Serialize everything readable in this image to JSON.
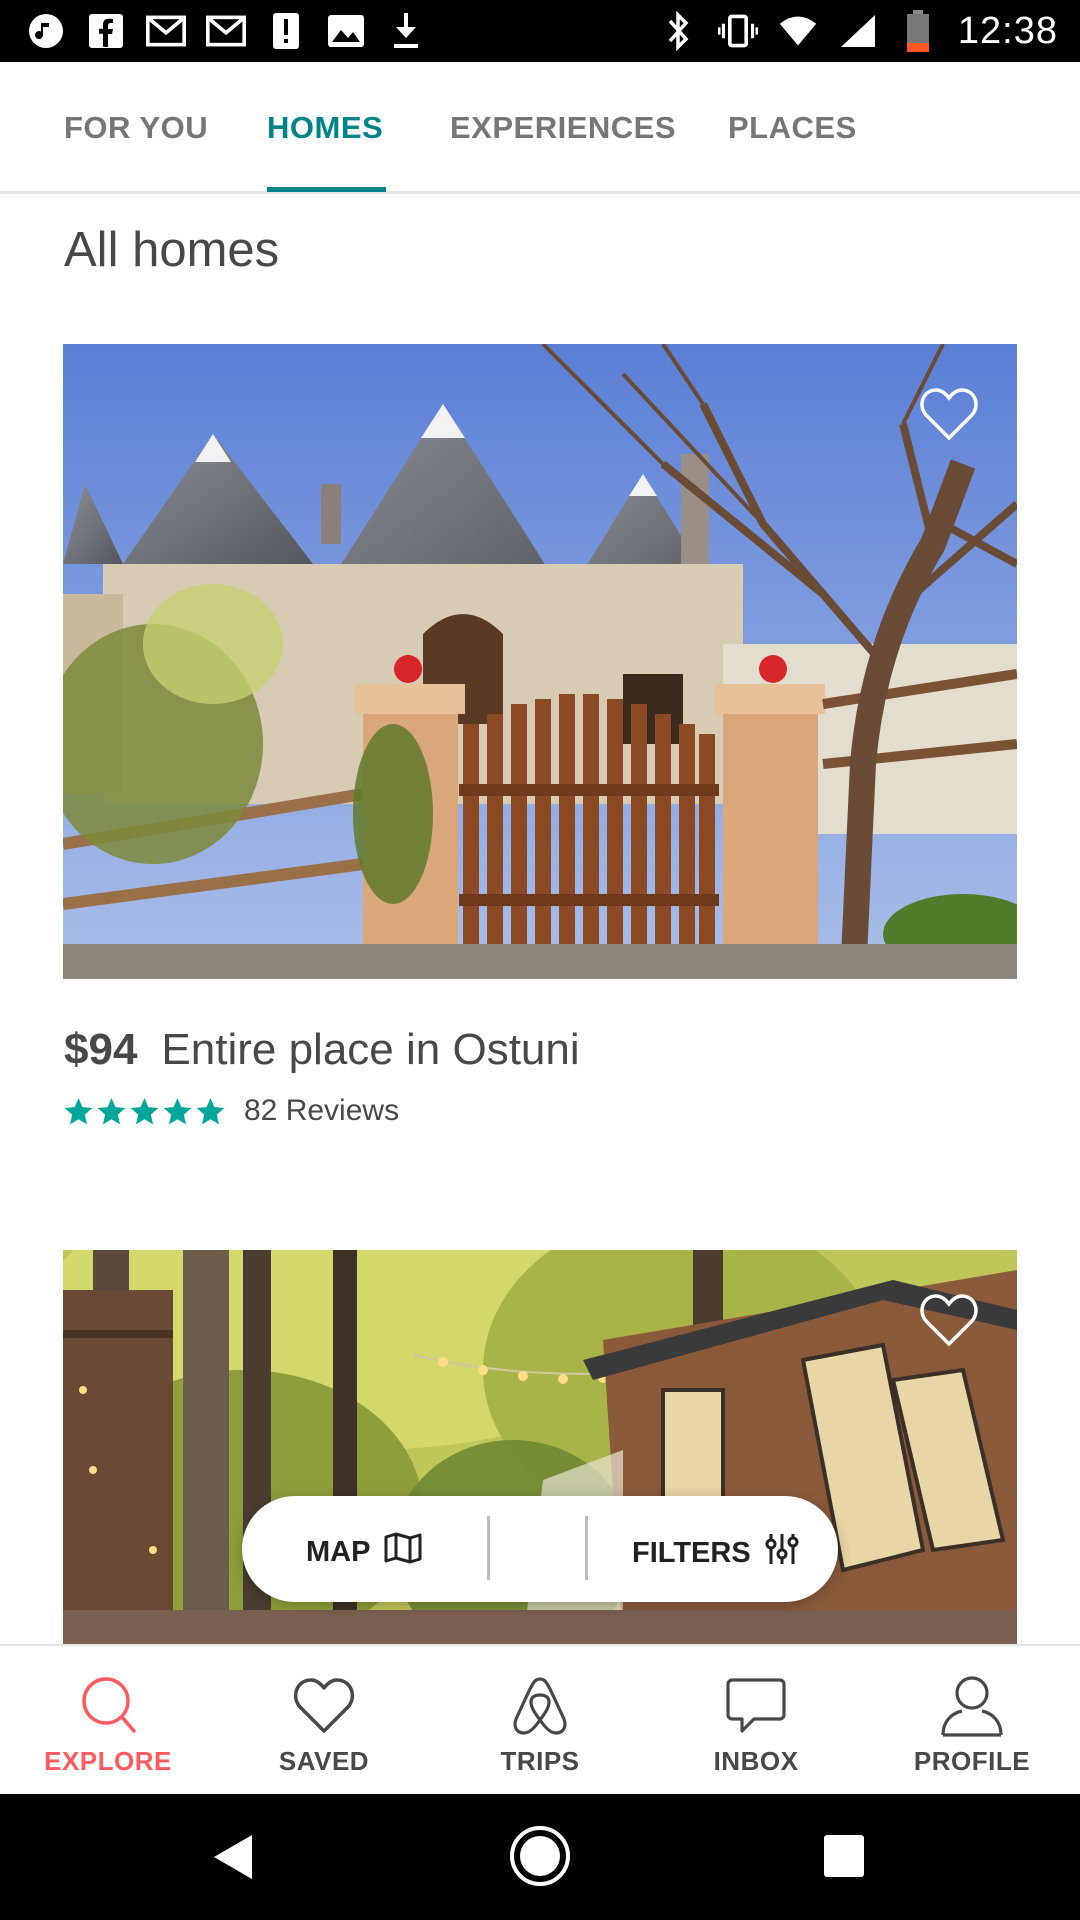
{
  "status_bar": {
    "time": "12:38",
    "left_icons": [
      "music-icon",
      "facebook-icon",
      "gmail-icon",
      "gmail-icon",
      "alert-icon",
      "image-icon",
      "download-icon"
    ],
    "right_icons": [
      "bluetooth-icon",
      "vibrate-icon",
      "wifi-icon",
      "signal-icon",
      "battery-icon"
    ]
  },
  "tabs": [
    {
      "label": "FOR YOU",
      "active": false
    },
    {
      "label": "HOMES",
      "active": true
    },
    {
      "label": "EXPERIENCES",
      "active": false
    },
    {
      "label": "PLACES",
      "active": false
    }
  ],
  "heading": "All homes",
  "listings": [
    {
      "price": "$94",
      "title": "Entire place in Ostuni",
      "rating": 5,
      "reviews": "82 Reviews"
    },
    {
      "price": "",
      "title": "",
      "reviews": ""
    }
  ],
  "floating_bar": {
    "map_label": "MAP",
    "filters_label": "FILTERS"
  },
  "bottom_nav": [
    {
      "label": "EXPLORE",
      "icon": "search-icon",
      "active": true
    },
    {
      "label": "SAVED",
      "icon": "heart-icon",
      "active": false
    },
    {
      "label": "TRIPS",
      "icon": "airbnb-logo-icon",
      "active": false
    },
    {
      "label": "INBOX",
      "icon": "chat-bubble-icon",
      "active": false
    },
    {
      "label": "PROFILE",
      "icon": "person-icon",
      "active": false
    }
  ],
  "colors": {
    "accent_teal": "#008489",
    "brand_red": "#ff5a5f",
    "star_teal": "#00a699"
  }
}
